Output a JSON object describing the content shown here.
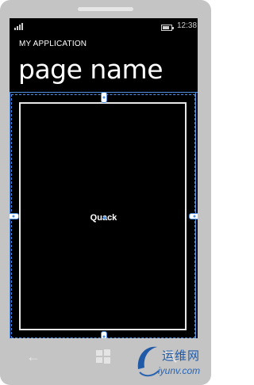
{
  "status_bar": {
    "time": "12:38"
  },
  "app": {
    "title": "MY APPLICATION"
  },
  "page": {
    "title": "page name"
  },
  "content": {
    "label": "Quack"
  },
  "nav": {
    "back_icon": "back-arrow-icon",
    "start_icon": "windows-logo-icon",
    "search_icon": "search-icon"
  },
  "watermark": {
    "brand": "运维网",
    "url": "iyunv.com"
  },
  "colors": {
    "screen": "#000000",
    "frame": "#c4c4c4",
    "adorner": "#4f8fe0",
    "watermark": "#1e5aa8"
  }
}
